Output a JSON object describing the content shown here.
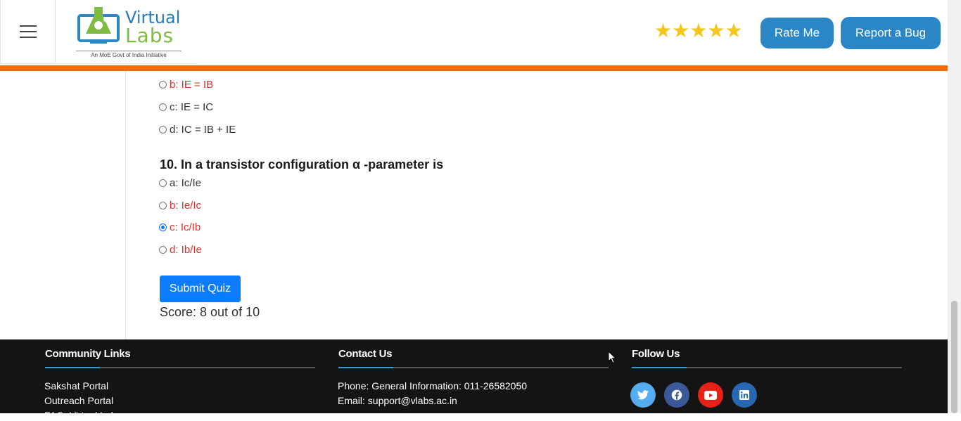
{
  "header": {
    "logo": {
      "title": "Virtual",
      "subtitle": "Labs",
      "tagline": "An MoE Govt of India Initiative"
    },
    "rating": {
      "stars": 5,
      "icon": "star-icon",
      "color": "#f5c518"
    },
    "rate_label": "Rate Me",
    "bug_label": "Report a Bug",
    "accent_color": "#ee6c12"
  },
  "quiz": {
    "prev_options": [
      {
        "text": "b: IE = IB",
        "state": "wrong"
      },
      {
        "text": "c: IE = IC",
        "state": "neutral"
      },
      {
        "text": "d: IC = IB + IE",
        "state": "neutral"
      }
    ],
    "question": "10. In a transistor configuration α -parameter is",
    "options": [
      {
        "text": "a: Ic/Ie",
        "state": "neutral",
        "checked": false
      },
      {
        "text": "b: Ie/Ic",
        "state": "wrong",
        "checked": false
      },
      {
        "text": "c: Ic/Ib",
        "state": "wrong",
        "checked": true
      },
      {
        "text": "d: Ib/Ie",
        "state": "wrong",
        "checked": false
      }
    ],
    "submit_label": "Submit Quiz",
    "score": "Score: 8 out of 10"
  },
  "footer": {
    "community": {
      "heading": "Community Links",
      "links": [
        "Sakshat Portal",
        "Outreach Portal",
        "FAQ: Virtual Labs"
      ]
    },
    "contact": {
      "heading": "Contact Us",
      "phone": "Phone: General Information: 011-26582050",
      "email": "Email: support@vlabs.ac.in"
    },
    "follow": {
      "heading": "Follow Us",
      "icons": [
        {
          "name": "twitter-icon",
          "color": "#55acee"
        },
        {
          "name": "facebook-icon",
          "color": "#3b5998"
        },
        {
          "name": "youtube-icon",
          "color": "#e62117"
        },
        {
          "name": "linkedin-icon",
          "color": "#0e76a8"
        }
      ]
    }
  }
}
